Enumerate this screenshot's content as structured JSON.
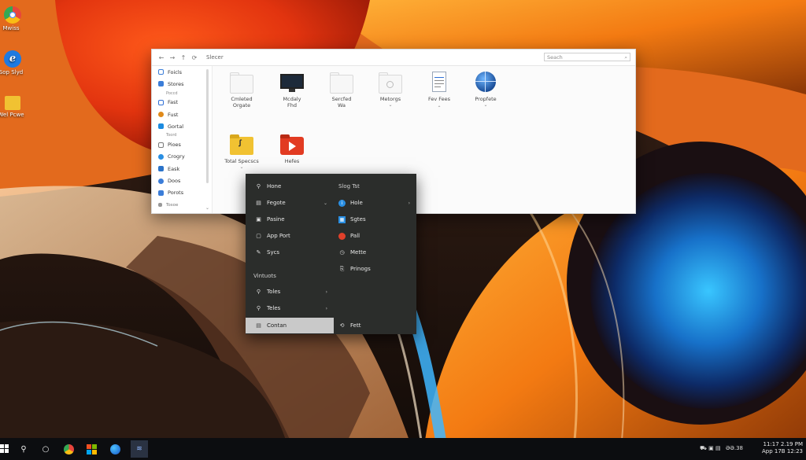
{
  "desktop": {
    "icons": [
      {
        "label": "Mwiss",
        "icon": "chrome-icon"
      },
      {
        "label": "Sop Slyd",
        "icon": "edge-icon"
      },
      {
        "label": "Wel Pcwe",
        "icon": "folder-icon"
      }
    ]
  },
  "explorer": {
    "address": "Slecer",
    "search_placeholder": "Seach",
    "sidebar": [
      {
        "label": "Foicls",
        "icon": "file-icon",
        "color": "#3b7dd8"
      },
      {
        "label": "Stores",
        "icon": "store-icon",
        "color": "#3b7dd8"
      },
      {
        "label": "Poccd",
        "small": true
      },
      {
        "label": "Fast",
        "icon": "document-icon",
        "color": "#2f6fd6"
      },
      {
        "label": "Fust",
        "icon": "globe-icon",
        "color": "#e08a1a"
      },
      {
        "label": "Gortal",
        "icon": "monitor-icon",
        "color": "#1c8be0"
      },
      {
        "label": "Toord",
        "small": true
      },
      {
        "label": "Pioes",
        "icon": "image-icon",
        "color": "#7a7a7a"
      },
      {
        "label": "Crogry",
        "icon": "globe-icon",
        "color": "#2a8fe3"
      },
      {
        "label": "Eask",
        "icon": "desktop-icon",
        "color": "#2b73c9"
      },
      {
        "label": "Doos",
        "icon": "gear-icon",
        "color": "#3b7dd8"
      },
      {
        "label": "Porots",
        "icon": "folder-icon",
        "color": "#3b7dd8"
      },
      {
        "label": "Tosoe",
        "icon": "shield-icon",
        "color": "#888"
      }
    ],
    "files": [
      {
        "label": "Cmleted\nOrgate",
        "icon": "folder-outline-icon",
        "chevron": false
      },
      {
        "label": "Mcdaly\nFhd",
        "icon": "monitor-icon",
        "chevron": false
      },
      {
        "label": "Sercfed\nWa",
        "icon": "folder-outline-icon",
        "chevron": false
      },
      {
        "label": "Metorgs",
        "icon": "folder-outline-icon",
        "chevron": true
      },
      {
        "label": "Fev Fees",
        "icon": "document-icon",
        "chevron": true
      },
      {
        "label": "Propfete",
        "icon": "globe-icon",
        "chevron": true
      },
      {
        "label": "Total Specscs",
        "icon": "yellow-folder-icon",
        "chevron": true
      },
      {
        "label": "Hefes",
        "icon": "video-folder-icon",
        "chevron": false
      }
    ]
  },
  "context_menu": {
    "left_items": [
      {
        "label": "Hone",
        "icon": "pin-icon",
        "arrow": false
      },
      {
        "label": "Fegote",
        "icon": "folder-icon",
        "arrow": true
      },
      {
        "label": "Pasine",
        "icon": "paste-icon",
        "arrow": false
      },
      {
        "label": "App Port",
        "icon": "window-icon",
        "arrow": false
      },
      {
        "label": "Sycs",
        "icon": "pen-icon",
        "arrow": false
      }
    ],
    "section_header": "Vintuots",
    "section_items": [
      {
        "label": "Toles",
        "icon": "search-icon",
        "arrow": true
      },
      {
        "label": "Teles",
        "icon": "search-icon",
        "arrow": true
      }
    ],
    "highlighted": {
      "label": "Contan",
      "icon": "folder-icon"
    },
    "right_header": "Slog Tst",
    "right_items": [
      {
        "label": "Hole",
        "icon": "info-icon",
        "color": "#2a8fe3",
        "arrow": true
      },
      {
        "label": "Sgtes",
        "icon": "grid-icon",
        "color": "#2a8fe3",
        "arrow": false
      },
      {
        "label": "Pall",
        "icon": "record-icon",
        "color": "#e0402a",
        "arrow": false
      },
      {
        "label": "Mette",
        "icon": "clock-icon",
        "color": "#dddddd",
        "arrow": false
      },
      {
        "label": "Prinogs",
        "icon": "share-icon",
        "color": "#dddddd",
        "arrow": false
      }
    ],
    "right_bottom": {
      "label": "Fett",
      "icon": "refresh-icon"
    }
  },
  "taskbar": {
    "icons": [
      "start-icon",
      "search-icon",
      "cortana-icon",
      "chrome-icon",
      "store-icon",
      "edge-icon",
      "app-icon"
    ],
    "tray_icons": "⛟ ▣ ▤",
    "tray_text": "ƏƏ.38",
    "time": "11:17 2.19 PM",
    "date": "App 17B 12:23"
  }
}
